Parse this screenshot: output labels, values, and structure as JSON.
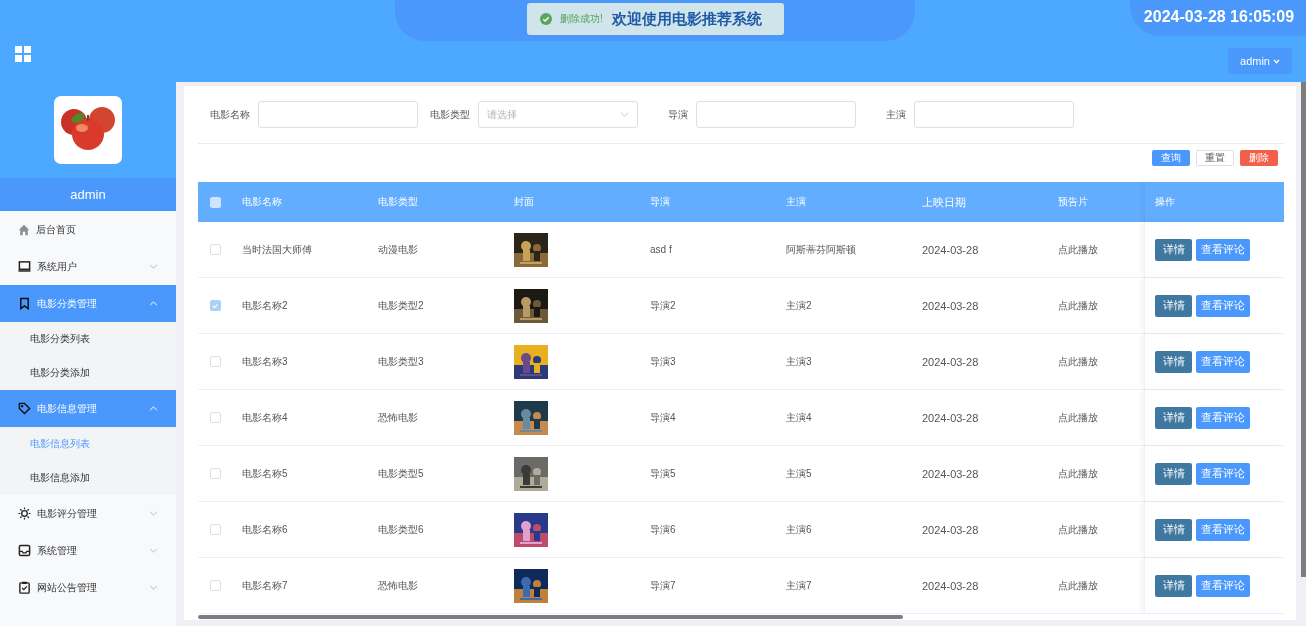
{
  "header": {
    "title": "欢迎使用电影推荐系统",
    "datetime": "2024-03-28 16:05:09",
    "user_menu": "admin"
  },
  "toast": {
    "kind": "success",
    "message": "删除成功!"
  },
  "sidebar": {
    "avatar": {
      "kind": "picture"
    },
    "username": "admin",
    "items": [
      {
        "label": "后台首页",
        "kind": "link"
      },
      {
        "label": "系统用户",
        "kind": "group",
        "expanded": false
      },
      {
        "label": "电影分类管理",
        "kind": "group",
        "expanded": true,
        "children": [
          {
            "label": "电影分类列表",
            "selected": false
          },
          {
            "label": "电影分类添加",
            "selected": false
          }
        ]
      },
      {
        "label": "电影信息管理",
        "kind": "group",
        "expanded": true,
        "children": [
          {
            "label": "电影信息列表",
            "selected": true
          },
          {
            "label": "电影信息添加",
            "selected": false
          }
        ]
      },
      {
        "label": "电影评分管理",
        "kind": "group",
        "expanded": false
      },
      {
        "label": "系统管理",
        "kind": "group",
        "expanded": false
      },
      {
        "label": "网站公告管理",
        "kind": "group",
        "expanded": false
      }
    ]
  },
  "filters": [
    {
      "label": "电影名称",
      "kind": "input"
    },
    {
      "label": "电影类型",
      "kind": "select",
      "placeholder": "请选择"
    },
    {
      "label": "导演",
      "kind": "input"
    },
    {
      "label": "主演",
      "kind": "input"
    }
  ],
  "actions": [
    {
      "label": "查询",
      "kind": "primary"
    },
    {
      "label": "重置",
      "kind": "plain"
    },
    {
      "label": "删除",
      "kind": "danger"
    }
  ],
  "table": {
    "all_checked": false,
    "columns": [
      "电影名称",
      "电影类型",
      "封面",
      "导演",
      "主演",
      "上映日期",
      "预告片",
      "操作"
    ],
    "rows": [
      {
        "checked": false,
        "name": "当时法国大师傅",
        "type": "动漫电影",
        "cover": {
          "kind": "picture"
        },
        "director": "asd f",
        "actor": "阿斯蒂芬阿斯顿",
        "date": "2024-03-28",
        "trailer": "点此播放",
        "buttons": [
          "详情",
          "查看评论"
        ]
      },
      {
        "checked": true,
        "name": "电影名称2",
        "type": "电影类型2",
        "cover": {
          "kind": "picture"
        },
        "director": "导演2",
        "actor": "主演2",
        "date": "2024-03-28",
        "trailer": "点此播放",
        "buttons": [
          "详情",
          "查看评论"
        ]
      },
      {
        "checked": false,
        "name": "电影名称3",
        "type": "电影类型3",
        "cover": {
          "kind": "picture"
        },
        "director": "导演3",
        "actor": "主演3",
        "date": "2024-03-28",
        "trailer": "点此播放",
        "buttons": [
          "详情",
          "查看评论"
        ]
      },
      {
        "checked": false,
        "name": "电影名称4",
        "type": "恐怖电影",
        "cover": {
          "kind": "picture"
        },
        "director": "导演4",
        "actor": "主演4",
        "date": "2024-03-28",
        "trailer": "点此播放",
        "buttons": [
          "详情",
          "查看评论"
        ]
      },
      {
        "checked": false,
        "name": "电影名称5",
        "type": "电影类型5",
        "cover": {
          "kind": "picture"
        },
        "director": "导演5",
        "actor": "主演5",
        "date": "2024-03-28",
        "trailer": "点此播放",
        "buttons": [
          "详情",
          "查看评论"
        ]
      },
      {
        "checked": false,
        "name": "电影名称6",
        "type": "电影类型6",
        "cover": {
          "kind": "picture"
        },
        "director": "导演6",
        "actor": "主演6",
        "date": "2024-03-28",
        "trailer": "点此播放",
        "buttons": [
          "详情",
          "查看评论"
        ]
      },
      {
        "checked": false,
        "name": "电影名称7",
        "type": "恐怖电影",
        "cover": {
          "kind": "picture"
        },
        "director": "导演7",
        "actor": "主演7",
        "date": "2024-03-28",
        "trailer": "点此播放",
        "buttons": [
          "详情",
          "查看评论"
        ]
      }
    ]
  }
}
